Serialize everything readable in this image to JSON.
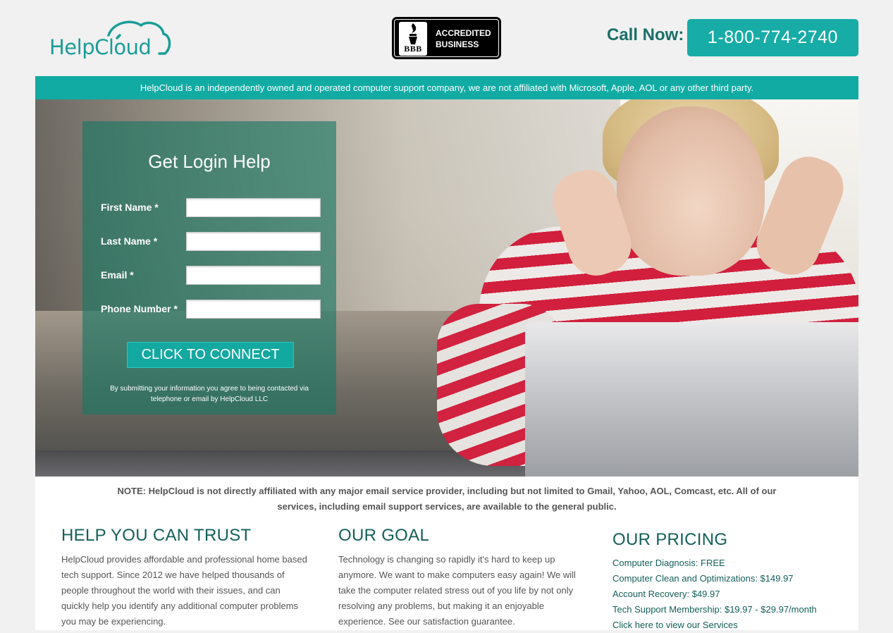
{
  "header": {
    "logo_text": "HelpCloud",
    "bbb": {
      "seal_text": "BBB",
      "line1": "ACCREDITED",
      "line2": "BUSINESS"
    },
    "call_label": "Call Now:",
    "phone": "1-800-774-2740"
  },
  "disclaimer_bar": "HelpCloud is an independently owned and operated computer support company, we are not affiliated with Microsoft, Apple, AOL or any other third party.",
  "form": {
    "title": "Get Login Help",
    "fields": [
      {
        "label": "First Name *",
        "value": ""
      },
      {
        "label": "Last Name *",
        "value": ""
      },
      {
        "label": "Email *",
        "value": ""
      },
      {
        "label": "Phone Number *",
        "value": ""
      }
    ],
    "submit_label": "CLICK TO CONNECT",
    "consent": "By submitting your information you agree to being contacted via telephone or email by HelpCloud LLC"
  },
  "note": "NOTE: HelpCloud is not directly affiliated with any major email service provider, including but not limited to Gmail, Yahoo, AOL, Comcast, etc. All of our services, including email support services, are available to the general public.",
  "columns": {
    "trust": {
      "title": "HELP YOU CAN TRUST",
      "body": "HelpCloud provides affordable and professional home based tech support. Since 2012 we have helped thousands of people throughout the world with their issues, and can quickly help you identify any additional computer problems you may be experiencing."
    },
    "goal": {
      "title": "OUR GOAL",
      "body": "Technology is changing so rapidly it's hard to keep up anymore. We want to make computers easy again! We will take the computer related stress out of you life by not only resolving any problems, but making it an enjoyable experience. See our satisfaction guarantee."
    },
    "pricing": {
      "title": "OUR PRICING",
      "items": [
        "Computer Diagnosis: FREE",
        "Computer Clean and Optimizations: $149.97",
        "Account Recovery: $49.97",
        "Tech Support Membership: $19.97 - $29.97/month"
      ],
      "link": "Click here to view our Services"
    }
  },
  "colors": {
    "brand_teal": "#17aca6",
    "dark_teal": "#14605a",
    "panel_green": "#177862"
  },
  "icons": [
    "cloud-icon",
    "bbb-torch-icon"
  ]
}
